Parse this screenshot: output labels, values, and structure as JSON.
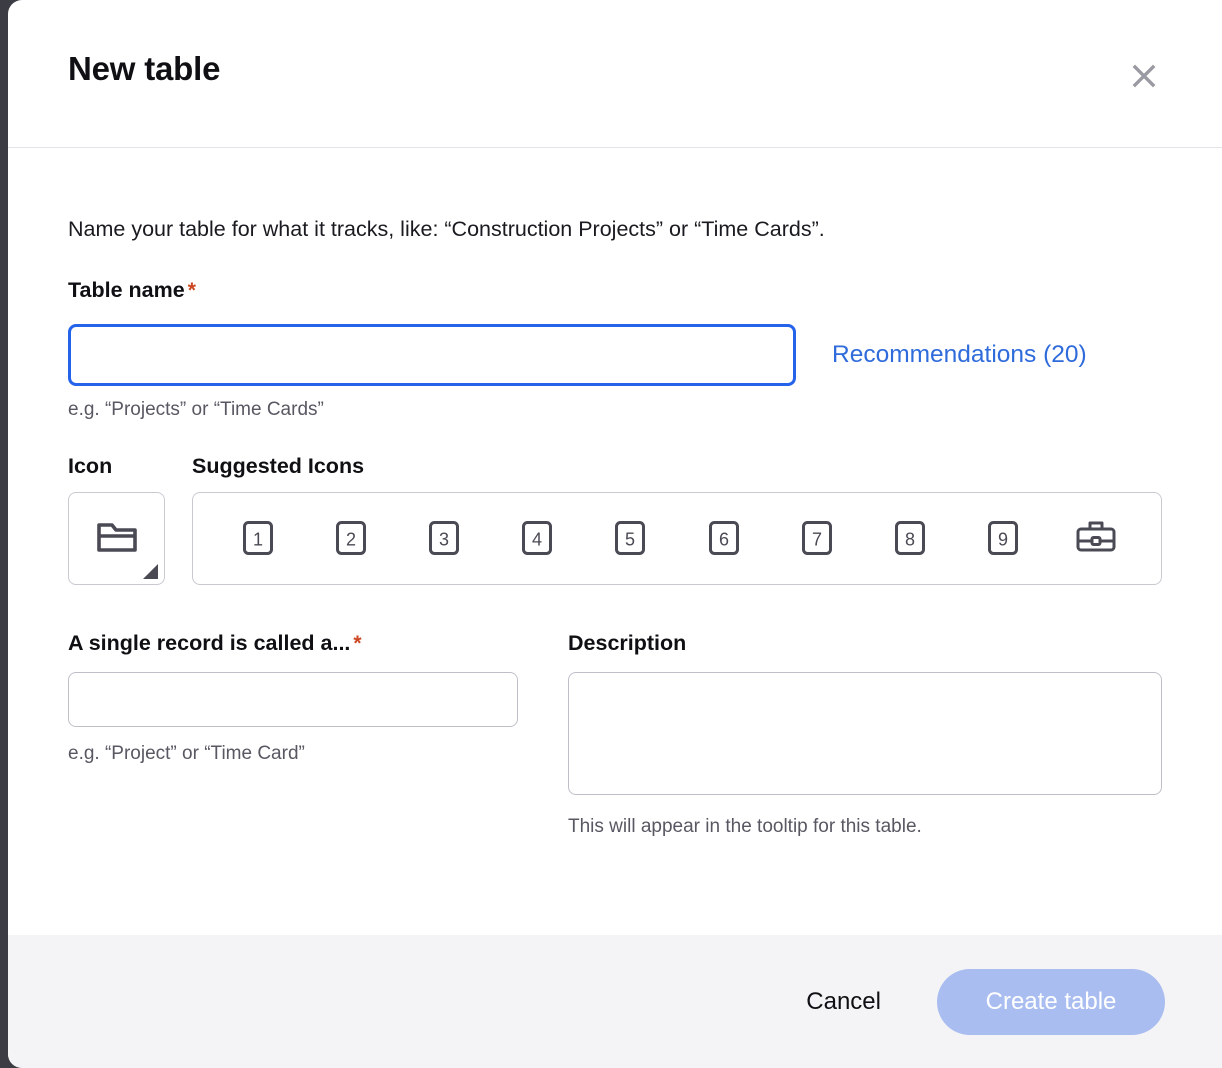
{
  "dialog": {
    "title": "New table",
    "close_icon": "close-icon",
    "intro": "Name your table for what it tracks, like: “Construction Projects” or “Time Cards”."
  },
  "table_name": {
    "label": "Table name",
    "required_marker": "*",
    "value": "",
    "placeholder": "",
    "helper": "e.g. “Projects” or “Time Cards”",
    "recommendations_link": "Recommendations (20)"
  },
  "icon": {
    "label": "Icon",
    "selected_icon": "folder-icon",
    "suggested_label": "Suggested Icons",
    "suggested": [
      {
        "name": "number-1-icon",
        "glyph": "1"
      },
      {
        "name": "number-2-icon",
        "glyph": "2"
      },
      {
        "name": "number-3-icon",
        "glyph": "3"
      },
      {
        "name": "number-4-icon",
        "glyph": "4"
      },
      {
        "name": "number-5-icon",
        "glyph": "5"
      },
      {
        "name": "number-6-icon",
        "glyph": "6"
      },
      {
        "name": "number-7-icon",
        "glyph": "7"
      },
      {
        "name": "number-8-icon",
        "glyph": "8"
      },
      {
        "name": "number-9-icon",
        "glyph": "9"
      },
      {
        "name": "briefcase-icon",
        "glyph": ""
      }
    ]
  },
  "record_name": {
    "label": "A single record is called a...",
    "required_marker": "*",
    "value": "",
    "placeholder": "",
    "helper": "e.g. “Project” or “Time Card”"
  },
  "description": {
    "label": "Description",
    "value": "",
    "placeholder": "",
    "helper": "This will appear in the tooltip for this table."
  },
  "footer": {
    "cancel_label": "Cancel",
    "create_label": "Create table"
  },
  "colors": {
    "focus_border": "#2563eb",
    "link": "#2f6bdb",
    "required_star": "#cc4621",
    "primary_button_disabled": "#a9bdf0",
    "footer_bg": "#f4f4f6",
    "icon_stroke": "#4a4a55",
    "page_backdrop": "#3c3c45"
  }
}
